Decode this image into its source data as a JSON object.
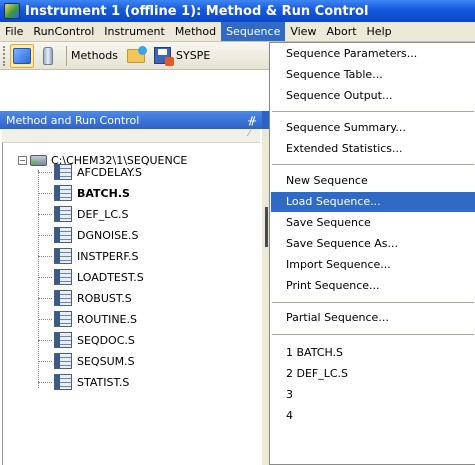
{
  "window": {
    "title": "Instrument 1 (offline 1): Method & Run Control"
  },
  "menubar": {
    "items": [
      "File",
      "RunControl",
      "Instrument",
      "Method",
      "Sequence",
      "View",
      "Abort",
      "Help"
    ],
    "active": "Sequence"
  },
  "toolbar": {
    "methods_label": "Methods",
    "sysp_label": "SYSPE"
  },
  "panel": {
    "title": "Method and Run Control",
    "pin_glyph": "⌥"
  },
  "tree": {
    "root": "C:\\CHEM32\\1\\SEQUENCE",
    "items": [
      {
        "label": "AFCDELAY.S",
        "bold": false
      },
      {
        "label": "BATCH.S",
        "bold": true
      },
      {
        "label": "DEF_LC.S",
        "bold": false
      },
      {
        "label": "DGNOISE.S",
        "bold": false
      },
      {
        "label": "INSTPERF.S",
        "bold": false
      },
      {
        "label": "LOADTEST.S",
        "bold": false
      },
      {
        "label": "ROBUST.S",
        "bold": false
      },
      {
        "label": "ROUTINE.S",
        "bold": false
      },
      {
        "label": "SEQDOC.S",
        "bold": false
      },
      {
        "label": "SEQSUM.S",
        "bold": false
      },
      {
        "label": "STATIST.S",
        "bold": false
      }
    ]
  },
  "sequence_menu": {
    "items": [
      "Sequence Parameters...",
      "Sequence Table...",
      "Sequence Output...",
      "Sequence Summary...",
      "Extended Statistics...",
      "New Sequence",
      "Load Sequence...",
      "Save Sequence",
      "Save Sequence As...",
      "Import Sequence...",
      "Print Sequence...",
      "Partial Sequence...",
      "1 BATCH.S",
      "2 DEF_LC.S",
      "3",
      "4"
    ],
    "highlighted": "Load Sequence..."
  },
  "colors": {
    "title_bar": "#1758dc",
    "menu_highlight": "#316ac5",
    "menubar_bg": "#ece9d8"
  }
}
